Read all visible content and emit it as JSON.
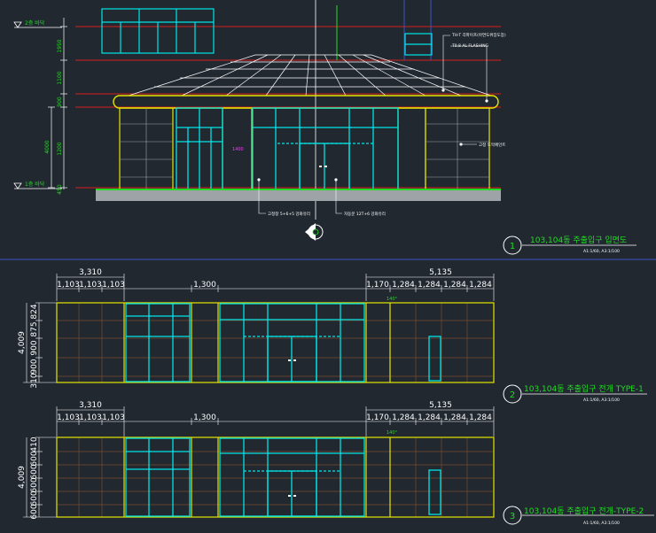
{
  "colors": {
    "background": "#212830",
    "cyan": "#00E5E5",
    "yellow": "#E5E500",
    "red": "#D81E1E",
    "green": "#22DD22",
    "white": "#FFFFFF",
    "grey": "#9EA3A8",
    "magenta": "#FF33FF",
    "divider": "#3A55C8",
    "brown": "#7A4A2A"
  },
  "elevation": {
    "levels": [
      {
        "label": "2층 바닥"
      },
      {
        "label": "1층 바닥"
      }
    ],
    "dims_left": [
      "1950",
      "1100",
      "900",
      "1200",
      "450"
    ],
    "dim_left_lower": "4000",
    "notes": [
      "TH-T 각파이프(아연도위장도장)",
      "T0.8 AL FLASHING",
      "고정 도막페인트",
      "고정창 5+6+5 강화유리",
      "자동문 12T+6 강화유리"
    ],
    "center_tag": "1400",
    "title": {
      "number": "1",
      "text": "103,104동 주출입구 입면도",
      "scale": "A1:1/60, A3:1/100"
    }
  },
  "unfold1": {
    "top_dims": {
      "group_left": "3,310",
      "group_right": "5,135",
      "segments": [
        "1,103",
        "1,103",
        "1,103",
        "1,300",
        "1,170",
        "1,284",
        "1,284",
        "1,284",
        "1,284"
      ]
    },
    "side_overall": "4,009",
    "side_dims": [
      "824",
      "875",
      "900",
      "900",
      "310"
    ],
    "angle_tag": "140°",
    "title": {
      "number": "2",
      "text": "103,104동 주출입구 전개 TYPE-1",
      "scale": "A1:1/60, A3:1/100"
    }
  },
  "unfold2": {
    "top_dims": {
      "group_left": "3,310",
      "group_right": "5,135",
      "segments": [
        "1,103",
        "1,103",
        "1,103",
        "1,300",
        "1,170",
        "1,284",
        "1,284",
        "1,284",
        "1,284"
      ]
    },
    "side_overall": "4,009",
    "side_dims": [
      "410",
      "600",
      "600",
      "600",
      "600",
      "600"
    ],
    "angle_tag": "140°",
    "title": {
      "number": "3",
      "text": "103,104동 주출입구 전개-TYPE-2",
      "scale": "A1:1/60, A3:1/100"
    }
  }
}
